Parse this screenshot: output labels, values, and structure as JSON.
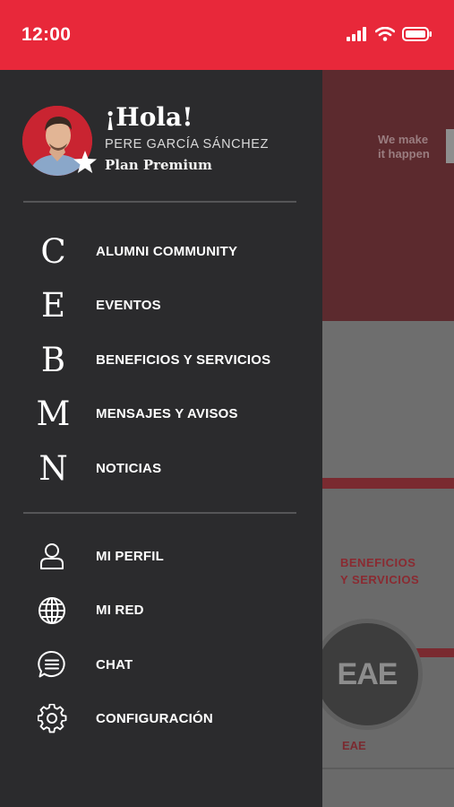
{
  "status_bar": {
    "time": "12:00"
  },
  "background_app": {
    "tagline": [
      "We make",
      "it happen"
    ],
    "benefits_label": [
      "BENEFICIOS",
      "Y SERVICIOS"
    ],
    "logo_text": "EAE",
    "bottom_label": "EAE"
  },
  "profile": {
    "greeting": "¡Hola!",
    "name": "PERE GARCÍA SÁNCHEZ",
    "plan": "Plan Premium"
  },
  "main_menu": [
    {
      "letter": "C",
      "label": "ALUMNI COMMUNITY"
    },
    {
      "letter": "E",
      "label": "EVENTOS"
    },
    {
      "letter": "B",
      "label": "BENEFICIOS Y SERVICIOS"
    },
    {
      "letter": "M",
      "label": "MENSAJES Y AVISOS"
    },
    {
      "letter": "N",
      "label": "NOTICIAS"
    }
  ],
  "secondary_menu": [
    {
      "icon": "user-icon",
      "label": "MI PERFIL"
    },
    {
      "icon": "globe-icon",
      "label": "MI RED"
    },
    {
      "icon": "chat-icon",
      "label": "CHAT"
    },
    {
      "icon": "gear-icon",
      "label": "CONFIGURACIÓN"
    }
  ],
  "colors": {
    "accent": "#e8283a",
    "drawer": "#2b2b2d"
  }
}
